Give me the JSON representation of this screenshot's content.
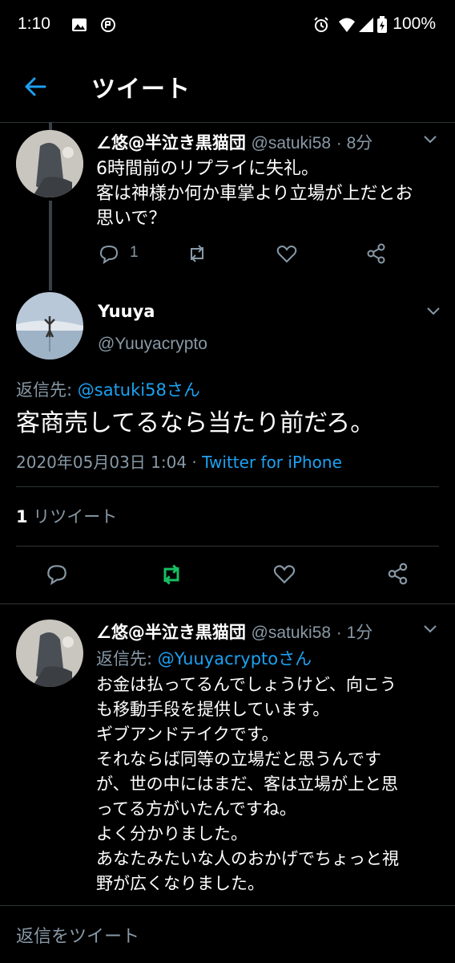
{
  "status_bar": {
    "time": "1:10",
    "battery": "100%"
  },
  "header": {
    "title": "ツイート"
  },
  "tweets": [
    {
      "display_name": "∠悠@半泣き黒猫団",
      "handle": "@satuki58",
      "time_ago": "· 8分",
      "text": "6時間前のリプライに失礼。\n客は神様か何か車掌より立場が上だとお\n思いで？",
      "reply_count": "1"
    },
    {
      "display_name": "∠悠@半泣き黒猫団",
      "handle": "@satuki58",
      "time_ago": "· 1分",
      "reply_to_prefix": "返信先: ",
      "reply_to_user": "@Yuuyacryptoさん",
      "text": "お金は払ってるんでしょうけど、向こう\nも移動手段を提供しています。\nギブアンドテイクです。\nそれならば同等の立場だと思うんです\nが、世の中にはまだ、客は立場が上と思\nってる方がいたんですね。\nよく分かりました。\nあなたみたいな人のおかげでちょっと視\n野が広くなりました。"
    }
  ],
  "main_tweet": {
    "display_name": "Yuuya",
    "handle": "@Yuuyacrypto",
    "reply_to_prefix": "返信先: ",
    "reply_to_user": "@satuki58さん",
    "text": "客商売してるなら当たり前だろ。",
    "date": "2020年05月03日 1:04 · ",
    "source": "Twitter for iPhone",
    "retweet_count": "1",
    "retweet_label": " リツイート"
  },
  "reply_bar": {
    "placeholder": "返信をツイート"
  },
  "colors": {
    "accent": "#1da1f2",
    "retweet_active": "#17bf63",
    "muted": "#8899a6"
  }
}
